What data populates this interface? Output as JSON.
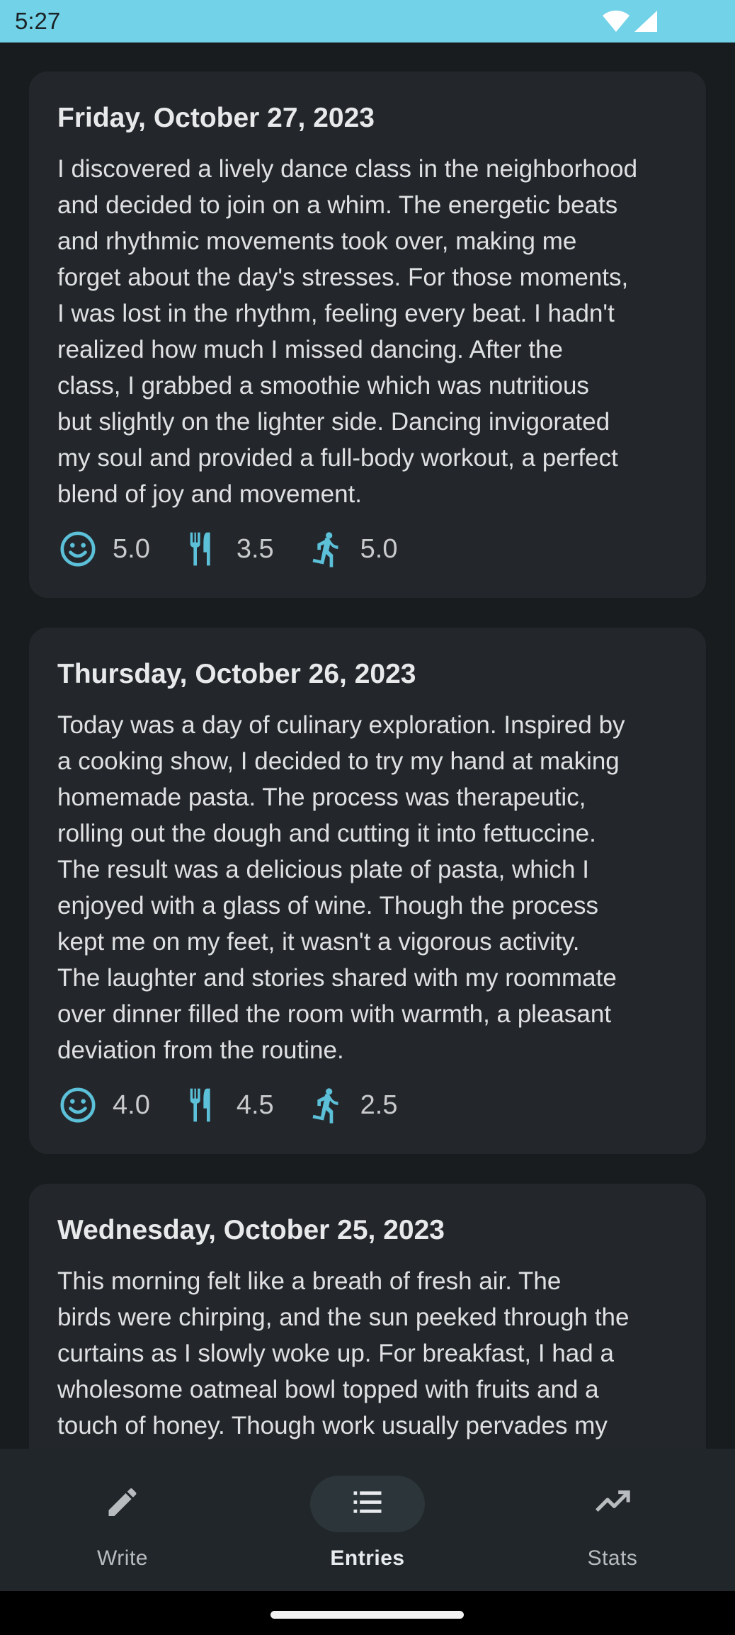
{
  "status_bar": {
    "time": "5:27"
  },
  "entries": [
    {
      "date": "Friday, October 27, 2023",
      "text": "I discovered a lively dance class in the neighborhood\nand decided to join on a whim. The energetic beats\nand rhythmic movements took over, making me\nforget about the day's stresses. For those moments,\nI was lost in the rhythm, feeling every beat. I hadn't\nrealized how much I missed dancing. After the\nclass, I grabbed a smoothie which was nutritious\nbut slightly on the lighter side. Dancing invigorated\nmy soul and provided a full-body workout, a perfect\nblend of joy and movement.",
      "mood": "5.0",
      "food": "3.5",
      "activity": "5.0"
    },
    {
      "date": "Thursday, October 26, 2023",
      "text": "Today was a day of culinary exploration. Inspired by\na cooking show, I decided to try my hand at making\nhomemade pasta. The process was therapeutic,\nrolling out the dough and cutting it into fettuccine.\nThe result was a delicious plate of pasta, which I\nenjoyed with a glass of wine. Though the process\nkept me on my feet, it wasn't a vigorous activity.\nThe laughter and stories shared with my roommate\nover dinner filled the room with warmth, a pleasant\ndeviation from the routine.",
      "mood": "4.0",
      "food": "4.5",
      "activity": "2.5"
    },
    {
      "date": "Wednesday, October 25, 2023",
      "text": "This morning felt like a breath of fresh air. The\nbirds were chirping, and the sun peeked through the\ncurtains as I slowly woke up. For breakfast, I had a\nwholesome oatmeal bowl topped with fruits and a\ntouch of honey. Though work usually pervades my"
    }
  ],
  "icons": {
    "mood": "smiley-face-icon",
    "food": "fork-knife-icon",
    "activity": "running-person-icon"
  },
  "nav": {
    "items": [
      {
        "label": "Write",
        "icon": "pencil-icon",
        "active": false
      },
      {
        "label": "Entries",
        "icon": "list-icon",
        "active": true
      },
      {
        "label": "Stats",
        "icon": "trending-up-icon",
        "active": false
      }
    ]
  },
  "colors": {
    "accent": "#5bc0d8",
    "status_bar": "#72d2e8",
    "background": "#191c1e",
    "card": "#23272b"
  }
}
